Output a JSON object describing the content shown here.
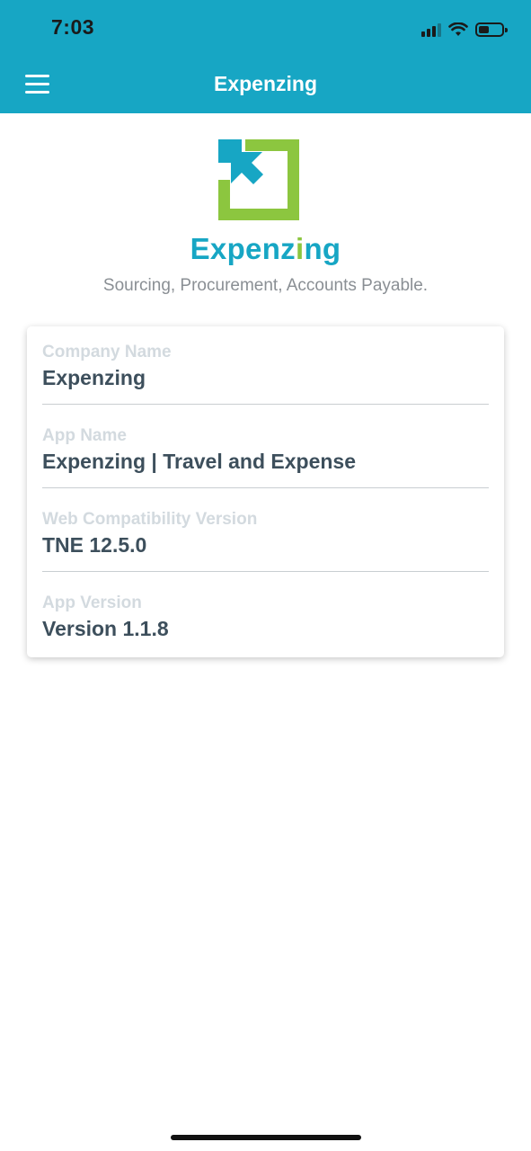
{
  "status_bar": {
    "time": "7:03",
    "icons": [
      "cellular-signal-icon",
      "wifi-icon",
      "battery-icon"
    ],
    "battery_level": 0.45
  },
  "nav": {
    "title": "Expenzing",
    "menu_icon": "hamburger-menu-icon"
  },
  "brand": {
    "name_part1": "Expenz",
    "name_highlight": "i",
    "name_part2": "ng",
    "tagline": "Sourcing, Procurement, Accounts Payable.",
    "colors": {
      "primary": "#17a6c4",
      "accent": "#8cc63f"
    }
  },
  "info": [
    {
      "label": "Company Name",
      "value": "Expenzing"
    },
    {
      "label": "App Name",
      "value": "Expenzing | Travel and Expense"
    },
    {
      "label": "Web Compatibility Version",
      "value": "TNE 12.5.0"
    },
    {
      "label": "App Version",
      "value": "Version 1.1.8"
    }
  ]
}
